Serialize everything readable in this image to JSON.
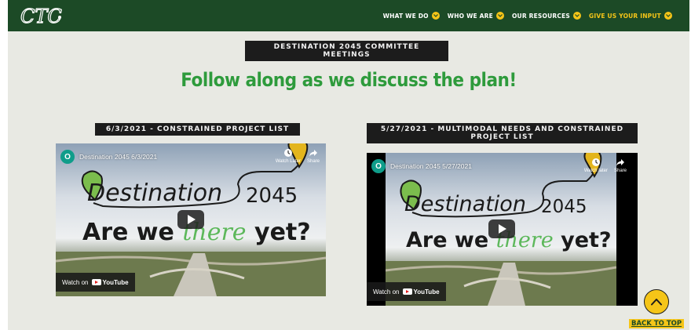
{
  "header": {
    "nav": [
      {
        "label": "WHAT WE DO",
        "icon": "chevron-down-icon"
      },
      {
        "label": "WHO WE ARE",
        "icon": "chevron-down-icon"
      },
      {
        "label": "OUR RESOURCES",
        "icon": "chevron-down-icon"
      },
      {
        "label": "GIVE US YOUR INPUT",
        "icon": "chevron-down-icon"
      }
    ],
    "colors": {
      "bar": "#1c4a26",
      "accent": "#f5c518"
    }
  },
  "section": {
    "label": "DESTINATION 2045 COMMITTEE MEETINGS",
    "headline": "Follow along as we discuss the plan!",
    "headline_color": "#2e9b3c"
  },
  "videos": [
    {
      "label": "6/3/2021 - CONSTRAINED PROJECT LIST",
      "channel_initial": "O",
      "title": "Destination 2045 6/3/2021",
      "actions": [
        "Watch Later",
        "Share"
      ],
      "brand_word": "Destination",
      "brand_year": "2045",
      "tagline_start": "Are we",
      "tagline_there": "there",
      "tagline_end": "yet?",
      "watch_on": "Watch on",
      "youtube": "YouTube"
    },
    {
      "label": "5/27/2021 - MULTIMODAL NEEDS AND CONSTRAINED PROJECT LIST",
      "channel_initial": "O",
      "title": "Destination 2045 5/27/2021",
      "actions": [
        "Watch later",
        "Share"
      ],
      "brand_word": "Destination",
      "brand_year": "2045",
      "tagline_start": "Are we",
      "tagline_there": "there",
      "tagline_end": "yet?",
      "watch_on": "Watch on",
      "youtube": "YouTube"
    }
  ],
  "back_to_top": "BACK TO TOP"
}
